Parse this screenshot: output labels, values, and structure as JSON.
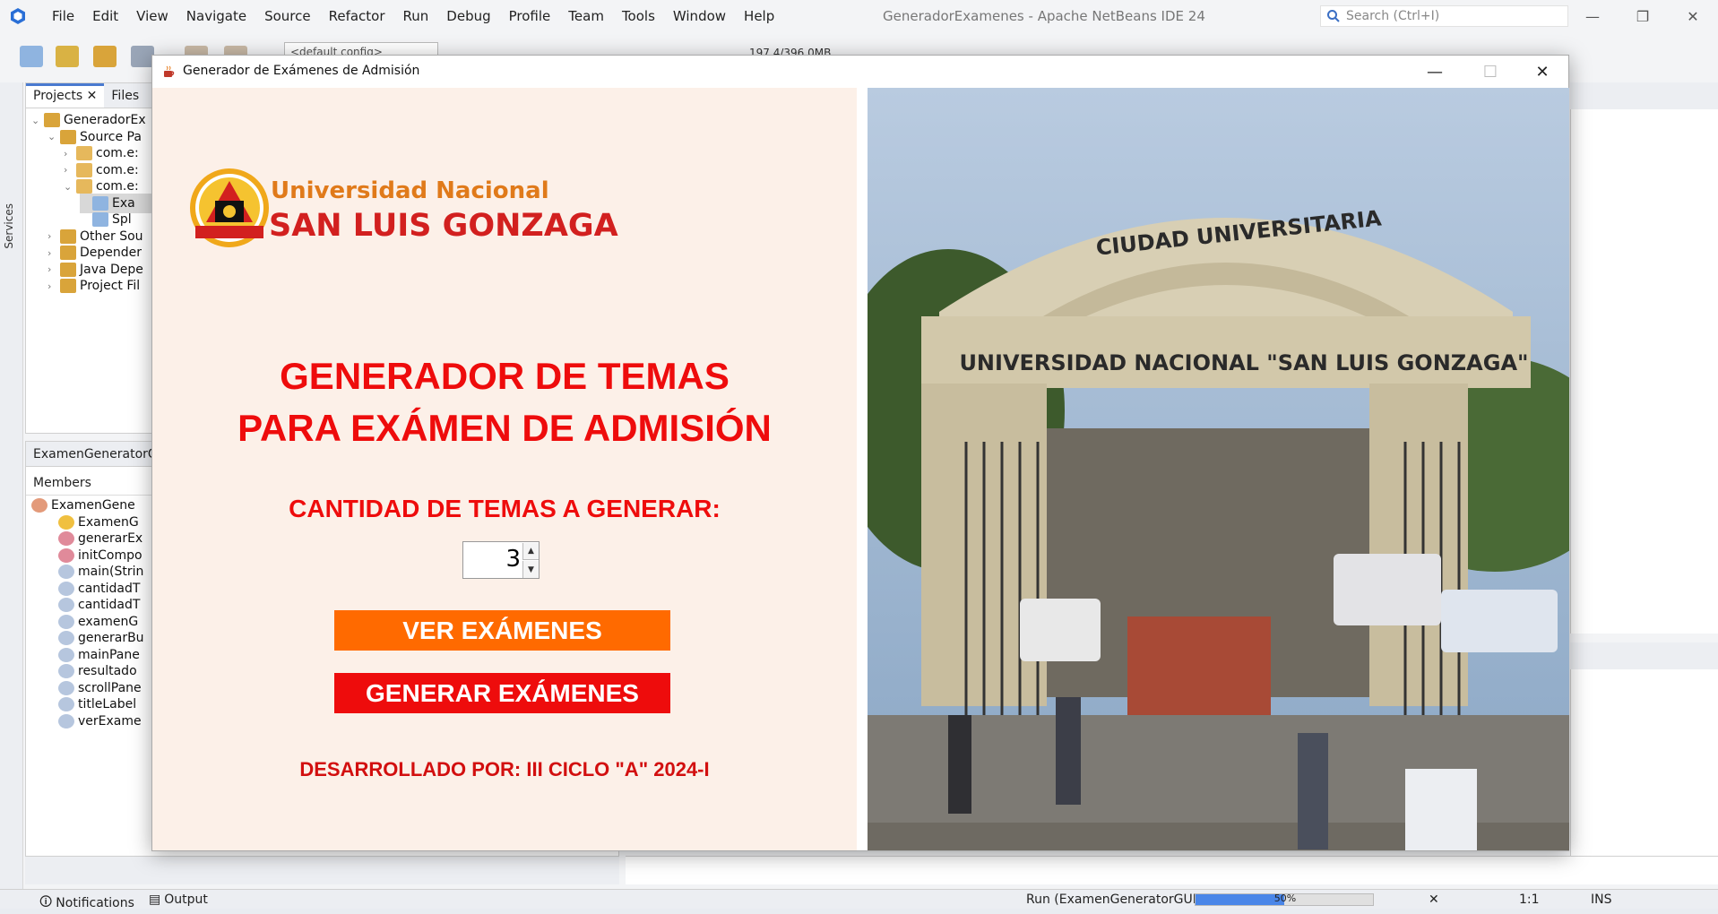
{
  "ide": {
    "menu": [
      "File",
      "Edit",
      "View",
      "Navigate",
      "Source",
      "Refactor",
      "Run",
      "Debug",
      "Profile",
      "Team",
      "Tools",
      "Window",
      "Help"
    ],
    "window_title": "GeneradorExamenes - Apache NetBeans IDE 24",
    "search_placeholder": "Search (Ctrl+I)",
    "config_combo": "<default config>",
    "memory": "197.4/396.0MB",
    "side_strip_label": "Services",
    "projects_tabs": [
      "Projects",
      "Files"
    ],
    "tree": [
      {
        "label": "GeneradorEx",
        "indent": 0,
        "chev": "v"
      },
      {
        "label": "Source Pa",
        "indent": 1,
        "chev": "v"
      },
      {
        "label": "com.e:",
        "indent": 2,
        "chev": ">"
      },
      {
        "label": "com.e:",
        "indent": 2,
        "chev": ">"
      },
      {
        "label": "com.e:",
        "indent": 2,
        "chev": "v"
      },
      {
        "label": "Exa",
        "indent": 3,
        "chev": "",
        "selected": true
      },
      {
        "label": "Spl",
        "indent": 3,
        "chev": ""
      },
      {
        "label": "Other Sou",
        "indent": 1,
        "chev": ">"
      },
      {
        "label": "Depender",
        "indent": 1,
        "chev": ">"
      },
      {
        "label": "Java Depe",
        "indent": 1,
        "chev": ">"
      },
      {
        "label": "Project Fil",
        "indent": 1,
        "chev": ">"
      }
    ],
    "navigator_title": "ExamenGeneratorGUI",
    "members_label": "Members",
    "members": [
      "ExamenGene",
      "ExamenG",
      "generarEx",
      "initCompo",
      "main(Strin",
      "cantidadT",
      "cantidadT",
      "examenG",
      "generarBu",
      "mainPane",
      "resultado",
      "scrollPane",
      "titleLabel",
      "verExame"
    ],
    "status": {
      "notifications": "Notifications",
      "output": "Output",
      "run_label": "Run (ExamenGeneratorGUI)",
      "progress_percent": 50,
      "progress_text": "50%",
      "position": "1:1",
      "mode": "INS"
    }
  },
  "dialog": {
    "title": "Generador de Exámenes de Admisión",
    "university_line1": "Universidad Nacional",
    "university_line2": "SAN LUIS GONZAGA",
    "heading_line1": "GENERADOR DE TEMAS",
    "heading_line2": "PARA EXÁMEN DE ADMISIÓN",
    "quantity_label": "CANTIDAD DE TEMAS A GENERAR:",
    "quantity_value": "3",
    "view_button": "VER EXÁMENES",
    "generate_button": "GENERAR EXÁMENES",
    "credits": "DESARROLLADO POR: III CICLO \"A\" 2024-I",
    "photo_sign_top": "CIUDAD UNIVERSITARIA",
    "photo_sign_main": "UNIVERSIDAD NACIONAL \"SAN LUIS GONZAGA\""
  },
  "colors": {
    "accent_red": "#ee0c0c",
    "accent_orange": "#ff6a00",
    "panel_bg": "#fcf0e8"
  }
}
